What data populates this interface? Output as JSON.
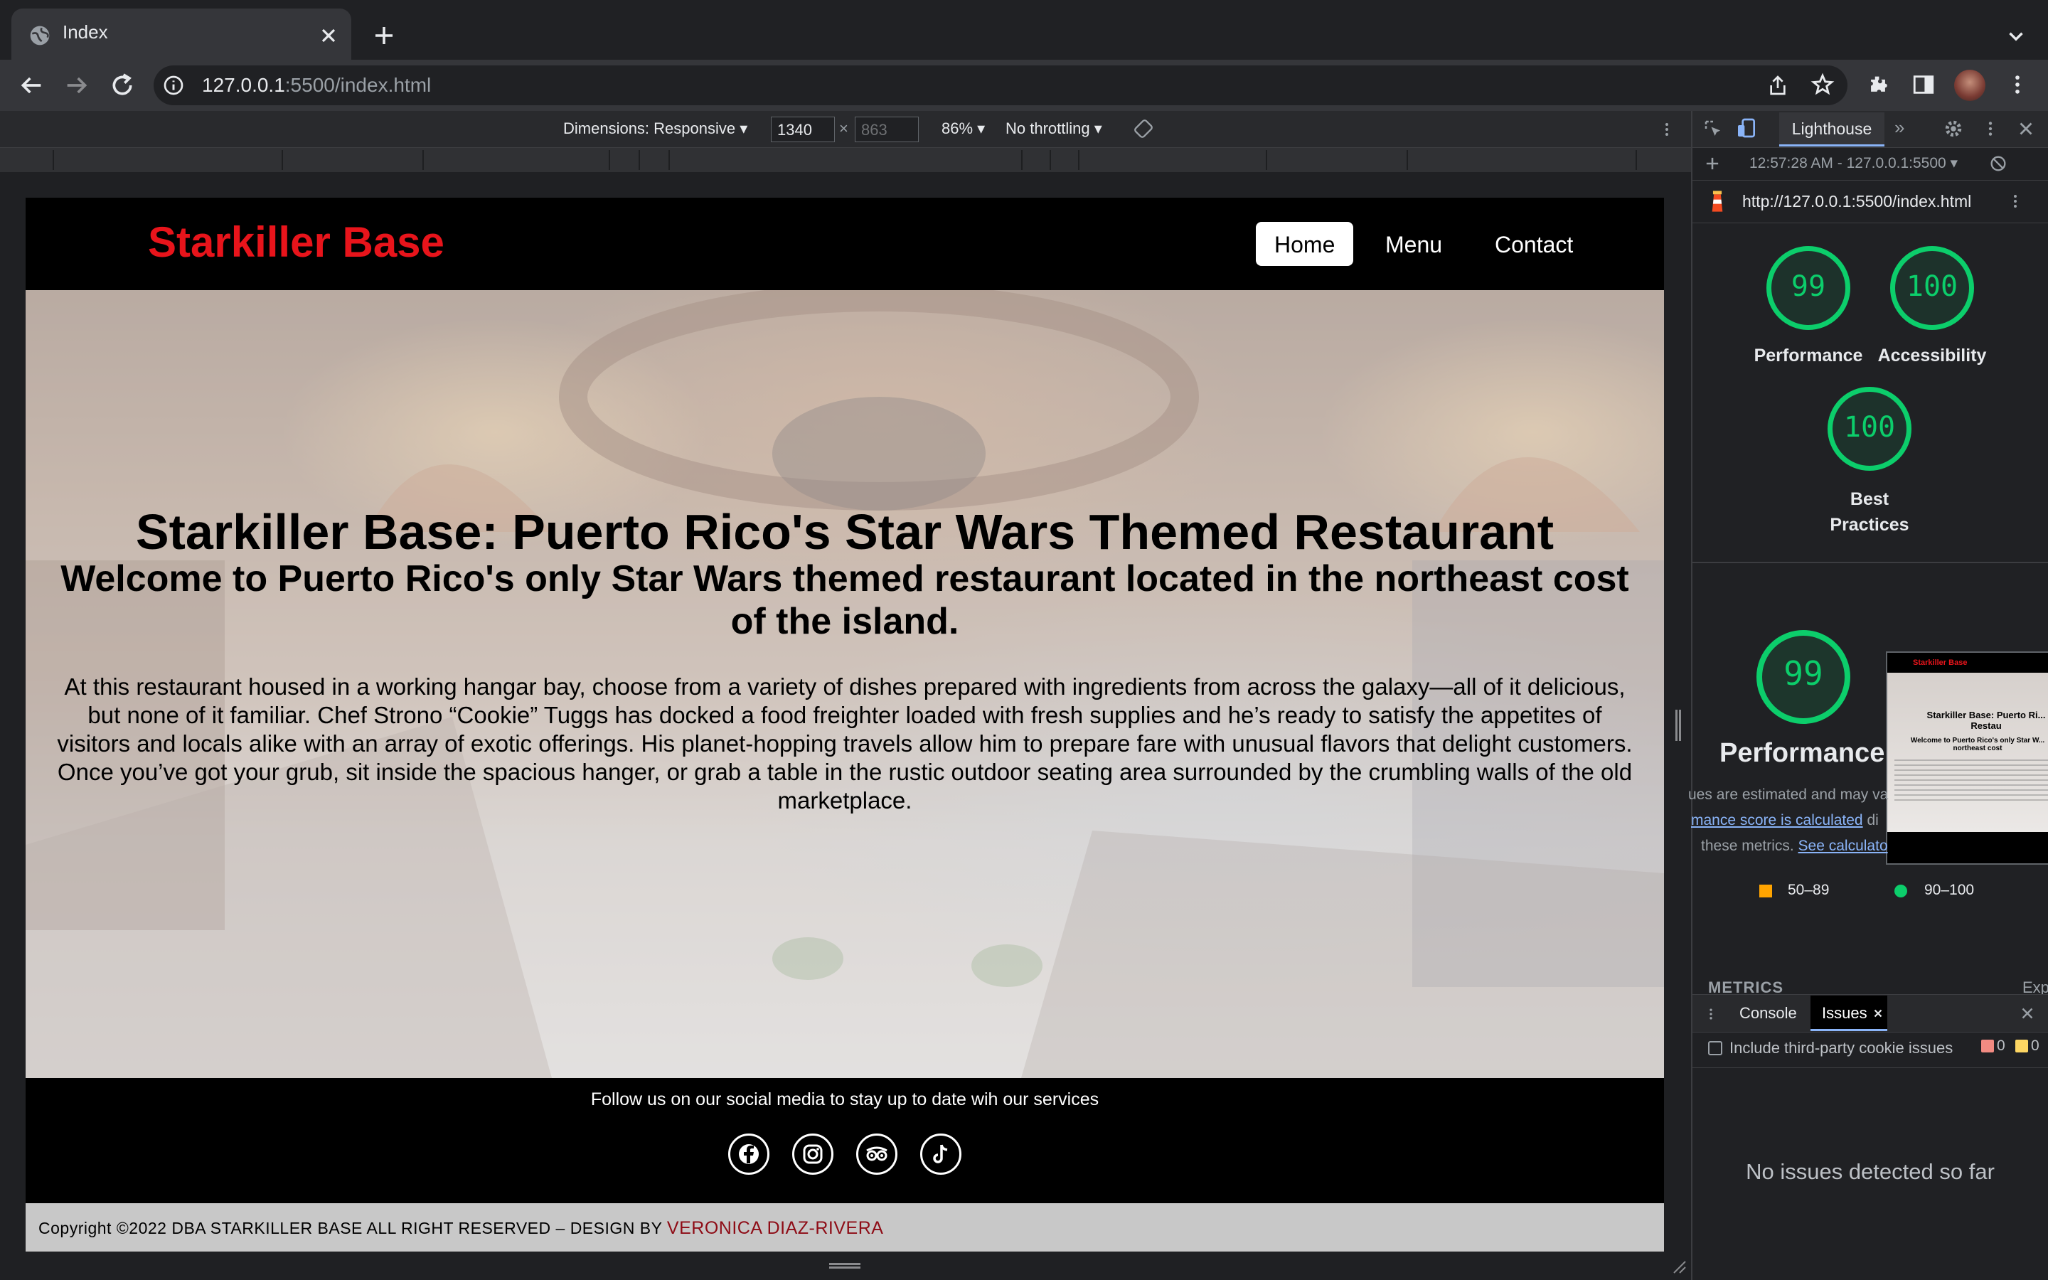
{
  "browser": {
    "tab_title": "Index",
    "url_host": "127.0.0.1",
    "url_rest": ":5500/index.html"
  },
  "device_toolbar": {
    "dimensions_label": "Dimensions: Responsive",
    "width": "1340",
    "height_placeholder": "863",
    "zoom": "86%",
    "throttling": "No throttling"
  },
  "site": {
    "logo": "Starkiller Base",
    "nav": [
      {
        "label": "Home"
      },
      {
        "label": "Menu"
      },
      {
        "label": "Contact"
      }
    ],
    "hero_title": "Starkiller Base: Puerto Rico's Star Wars Themed Restaurant",
    "hero_subtitle": "Welcome to Puerto Rico's only Star Wars themed restaurant located in the northeast cost of the island.",
    "hero_paragraph_1": "At this restaurant housed in a working hangar bay, choose from a variety of dishes prepared with ingredients from across the galaxy—all of it delicious, but none of it familiar. Chef Strono “Cookie” Tuggs has docked a food freighter loaded with fresh supplies and he’s ready to satisfy the appetites of visitors and locals alike with an array of exotic offerings. His planet-hopping travels allow him to prepare fare with unusual flavors that delight customers.",
    "hero_paragraph_2": "Once you’ve got your grub, sit inside the spacious hanger, or grab a table in the rustic outdoor seating area surrounded by the crumbling walls of the old marketplace.",
    "follow_text": "Follow us on our social media to stay up to date wih our services",
    "social_icons": [
      "facebook-icon",
      "instagram-icon",
      "tripadvisor-icon",
      "tiktok-icon"
    ],
    "copyright_prefix": "Copyright ©2022 DBA STARKILLER BASE ALL RIGHT RESERVED – DESIGN BY",
    "designer": "VERONICA DIAZ-RIVERA",
    "colors": {
      "logo": "#e8141b",
      "designer": "#8e0c16",
      "footer_bg": "#000000",
      "copyright_bg": "#c8c8c8"
    }
  },
  "devtools": {
    "active_tab": "Lighthouse",
    "report_time": "12:57:28 AM - 127.0.0.1:5500",
    "report_url": "http://127.0.0.1:5500/index.html",
    "scores": [
      {
        "value": "99",
        "label": "Performance"
      },
      {
        "value": "100",
        "label": "Accessibility"
      },
      {
        "value": "100",
        "label": "Best Practices"
      }
    ],
    "big_score": "99",
    "big_label": "Performance",
    "note_1": "ues are estimated and may va",
    "note_2_link": "mance score is calculated",
    "note_2_rest": " di",
    "note_3": "these metrics. ",
    "note_3_link": "See calculato",
    "legend_mid": "50–89",
    "legend_high": "90–100",
    "metrics_label": "METRICS",
    "metrics_expand": "Exp",
    "preview": {
      "logo": "Starkiller Base",
      "title": "Starkiller Base: Puerto Ri... Restau",
      "subtitle": "Welcome to Puerto Rico's only Star W... northeast cost"
    },
    "drawer_tabs": [
      "Console",
      "Issues"
    ],
    "third_party_label": "Include third-party cookie issues",
    "error_count": "0",
    "warning_count": "0",
    "no_issues": "No issues detected so far",
    "colors": {
      "pass": "#0cce6b",
      "average": "#ffa400"
    }
  }
}
